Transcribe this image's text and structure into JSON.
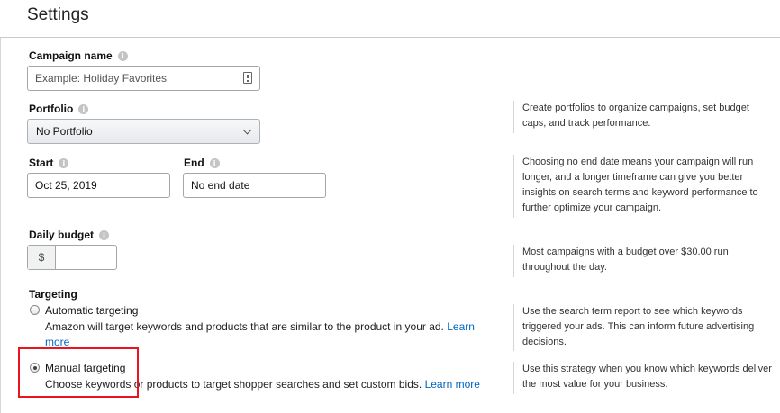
{
  "header": {
    "title": "Settings"
  },
  "campaign_name": {
    "label": "Campaign name",
    "placeholder": "Example: Holiday Favorites"
  },
  "portfolio": {
    "label": "Portfolio",
    "selected": "No Portfolio",
    "help": "Create portfolios to organize campaigns, set budget caps, and track performance."
  },
  "dates": {
    "start_label": "Start",
    "start_value": "Oct 25, 2019",
    "end_label": "End",
    "end_value": "No end date",
    "help": "Choosing no end date means your campaign will run longer, and a longer timeframe can give you better insights on search terms and keyword performance to further optimize your campaign."
  },
  "budget": {
    "label": "Daily budget",
    "currency": "$",
    "value": "",
    "help": "Most campaigns with a budget over $30.00 run throughout the day."
  },
  "targeting": {
    "label": "Targeting",
    "options": [
      {
        "title": "Automatic targeting",
        "desc": "Amazon will target keywords and products that are similar to the product in your ad.",
        "link": "Learn more",
        "checked": false,
        "help": "Use the search term report to see which keywords triggered your ads. This can inform future advertising decisions."
      },
      {
        "title": "Manual targeting",
        "desc": "Choose keywords or products to target shopper searches and set custom bids.",
        "link": "Learn more",
        "checked": true,
        "help": "Use this strategy when you know which keywords deliver the most value for your business."
      }
    ]
  },
  "colors": {
    "link": "#0066c0",
    "highlight": "#e8141f"
  }
}
